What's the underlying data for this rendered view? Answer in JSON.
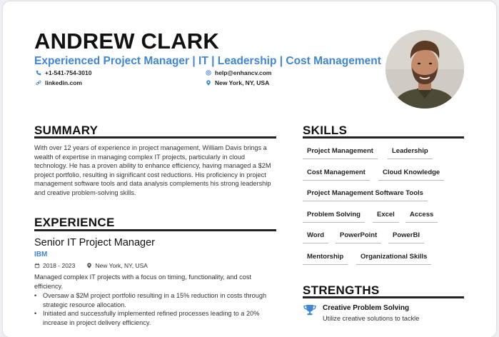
{
  "header": {
    "name": "ANDREW CLARK",
    "headline": "Experienced Project Manager | IT | Leadership | Cost Management",
    "phone": "+1-541-754-3010",
    "email": "help@enhancv.com",
    "website": "linkedin.com",
    "location": "New York, NY, USA"
  },
  "summary": {
    "title": "SUMMARY",
    "text": "With over 12 years of experience in project management, William Davis brings a wealth of expertise in managing complex IT projects, particularly in cloud technology. He has a proven ability to enhance efficiency, having managed a $2M project portfolio, resulting in significant cost reductions. His proficiency in project management software tools and data analysis complements his strong leadership and creative problem-solving skills."
  },
  "experience": {
    "title": "EXPERIENCE",
    "job_title": "Senior IT Project Manager",
    "company": "IBM",
    "dates": "2018 - 2023",
    "location": "New York, NY, USA",
    "description": "Managed complex IT projects with a focus on timing, functionality, and cost efficiency.",
    "bullets": [
      "Oversaw a $2M project portfolio resulting in a 15% reduction in costs through strategic resource allocation.",
      "Initiated and successfully implemented refined processes leading to a 20% increase in project delivery efficiency."
    ]
  },
  "skills": {
    "title": "SKILLS",
    "items": [
      "Project Management",
      "Leadership",
      "Cost Management",
      "Cloud Knowledge",
      "Project Management Software Tools",
      "Problem Solving",
      "Excel",
      "Access",
      "Word",
      "PowerPoint",
      "PowerBI",
      "Mentorship",
      "Organizational Skills"
    ]
  },
  "strengths": {
    "title": "STRENGTHS",
    "items": [
      {
        "title": "Creative Problem Solving",
        "description": "Utilize creative solutions to tackle"
      }
    ]
  },
  "colors": {
    "accent": "#3f86d6",
    "text": "#222222",
    "rule": "#222222"
  }
}
